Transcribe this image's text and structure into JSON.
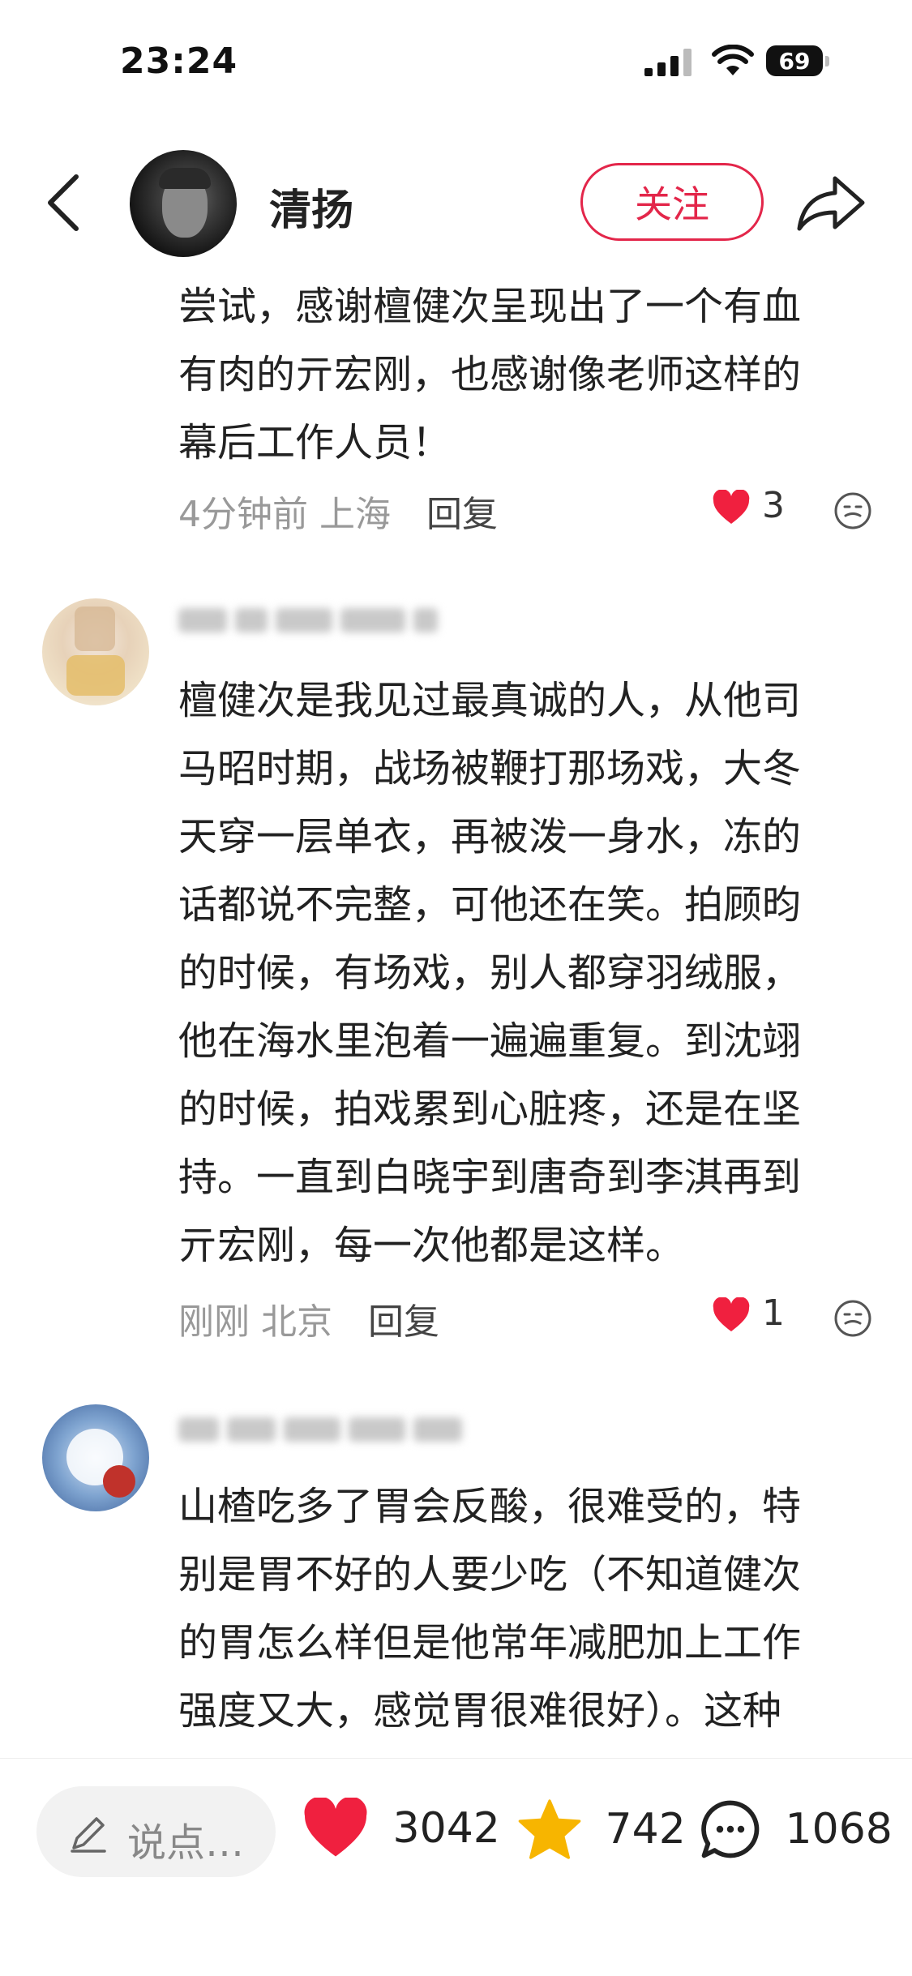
{
  "status_bar": {
    "time": "23:24",
    "battery": "69"
  },
  "header": {
    "username": "清扬",
    "follow_label": "关注"
  },
  "comments": [
    {
      "lines": [
        "尝试，感谢檀健次呈现出了一个有血",
        "有肉的亓宏刚，也感谢像老师这样的",
        "幕后工作人员！"
      ],
      "time": "4分钟前",
      "location": "上海",
      "reply_label": "回复",
      "likes": "3"
    },
    {
      "lines": [
        "檀健次是我见过最真诚的人，从他司",
        "马昭时期，战场被鞭打那场戏，大冬",
        "天穿一层单衣，再被泼一身水，冻的",
        "话都说不完整，可他还在笑。拍顾昀",
        "的时候，有场戏，别人都穿羽绒服，",
        "他在海水里泡着一遍遍重复。到沈翊",
        "的时候，拍戏累到心脏疼，还是在坚",
        "持。一直到白晓宇到唐奇到李淇再到",
        "亓宏刚，每一次他都是这样。"
      ],
      "time": "刚刚",
      "location": "北京",
      "reply_label": "回复",
      "likes": "1"
    },
    {
      "lines": [
        "山楂吃多了胃会反酸，很难受的，特",
        "别是胃不好的人要少吃（不知道健次",
        "的胃怎么样但是他常年减肥加上工作",
        "强度又大，感觉胃很难很好）。这种"
      ]
    }
  ],
  "bottom_bar": {
    "input_placeholder": "说点…",
    "likes_count": "3042",
    "favorites_count": "742",
    "comments_count": "1068"
  },
  "colors": {
    "accent": "#e3264a",
    "like_red": "#f0203f",
    "star_yellow": "#f7b500"
  }
}
